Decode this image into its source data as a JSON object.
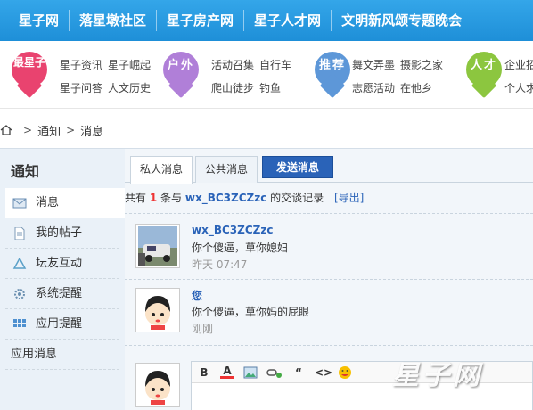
{
  "topnav": {
    "items": [
      "星子网",
      "落星墩社区",
      "星子房产网",
      "星子人才网",
      "文明新风颂专题晚会"
    ]
  },
  "categories": [
    {
      "pin": "最星子",
      "color": "#e9436f",
      "links": [
        "星子资讯",
        "星子崛起",
        "星子问答",
        "人文历史"
      ]
    },
    {
      "pin": "户外",
      "color": "#b07fd8",
      "links": [
        "活动召集",
        "自行车",
        "爬山徒步",
        "钓鱼"
      ]
    },
    {
      "pin": "推荐",
      "color": "#5d97d8",
      "links": [
        "舞文弄墨",
        "摄影之家",
        "志愿活动",
        "在他乡"
      ]
    },
    {
      "pin": "人才",
      "color": "#8cc63f",
      "links": [
        "企业招",
        "个人求"
      ]
    }
  ],
  "breadcrumb": {
    "items": [
      "通知",
      "消息"
    ]
  },
  "sidebar": {
    "title": "通知",
    "items": [
      {
        "label": "消息",
        "icon": "envelope-icon"
      },
      {
        "label": "我的帖子",
        "icon": "document-icon"
      },
      {
        "label": "坛友互动",
        "icon": "recycle-icon"
      },
      {
        "label": "系统提醒",
        "icon": "gear-icon"
      },
      {
        "label": "应用提醒",
        "icon": "grid-icon"
      },
      {
        "label": "应用消息",
        "icon": ""
      }
    ]
  },
  "tabs": {
    "private": "私人消息",
    "public": "公共消息",
    "send": "发送消息"
  },
  "summary": {
    "prefix": "共有",
    "count": "1",
    "mid": "条与",
    "user": "wx_BC3ZCZzc",
    "suffix": "的交谈记录",
    "export": "[导出]"
  },
  "messages": [
    {
      "name": "wx_BC3ZCZzc",
      "text": "你个傻逼，草你媳妇",
      "time": "昨天 07:47"
    },
    {
      "name": "您",
      "text": "你个傻逼，草你妈的屁眼",
      "time": "刚刚"
    }
  ],
  "editor": {
    "tools": [
      "B",
      "A",
      "image",
      "link",
      "“",
      "<>",
      "emoji"
    ]
  },
  "watermark": "星子网"
}
